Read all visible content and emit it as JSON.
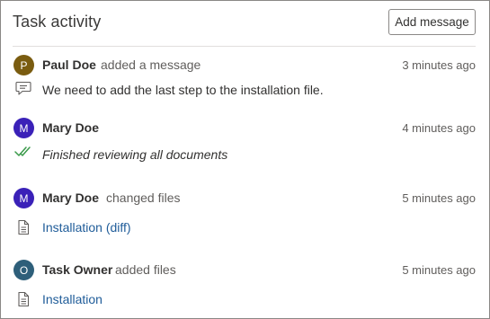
{
  "header": {
    "title": "Task activity",
    "add_message_label": "Add message"
  },
  "activities": [
    {
      "avatar_letter": "P",
      "avatar_color": "#7a5c10",
      "name": "Paul Doe",
      "action": "added a message",
      "time": "3 minutes ago",
      "detail_icon": "comment-icon",
      "detail_text": "We need to add the last step to the installation file."
    },
    {
      "avatar_letter": "M",
      "avatar_color": "#3a21b8",
      "name": "Mary Doe",
      "action": "",
      "time": "4 minutes ago",
      "detail_icon": "double-check-icon",
      "detail_text": "Finished reviewing all documents"
    },
    {
      "avatar_letter": "M",
      "avatar_color": "#3a21b8",
      "name": "Mary Doe",
      "action": "changed files",
      "time": "5 minutes ago",
      "detail_icon": "document-icon",
      "detail_link": "Installation (diff)"
    },
    {
      "avatar_letter": "O",
      "avatar_color": "#2e5f7a",
      "name": "Task Owner",
      "action": "added files",
      "time": "5 minutes ago",
      "detail_icon": "document-icon",
      "detail_link": "Installation"
    }
  ]
}
